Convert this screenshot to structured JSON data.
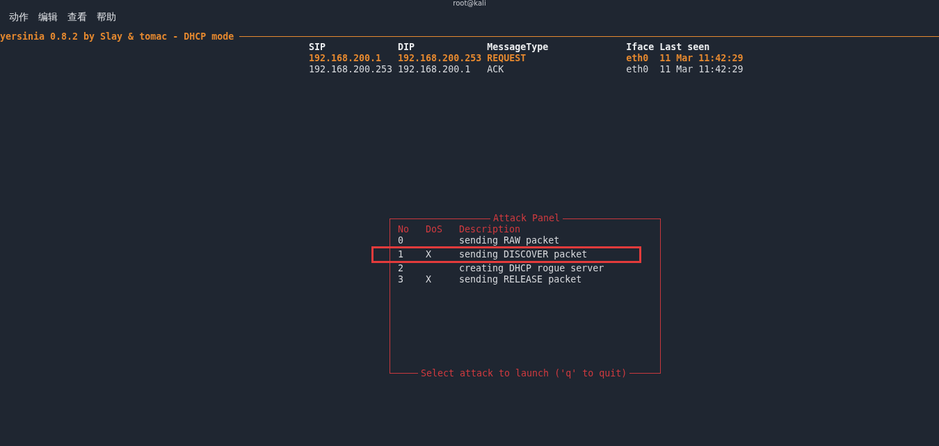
{
  "window": {
    "title": "root@kali"
  },
  "menu": [
    "动作",
    "编辑",
    "查看",
    "帮助"
  ],
  "app_title": "yersinia 0.8.2 by Slay & tomac - DHCP mode",
  "packets": {
    "columns": [
      "SIP",
      "DIP",
      "MessageType",
      "Iface",
      "Last seen"
    ],
    "rows": [
      {
        "cells": [
          "192.168.200.1",
          "192.168.200.253",
          "REQUEST",
          "eth0",
          "11 Mar 11:42:29"
        ],
        "selected": true
      },
      {
        "cells": [
          "192.168.200.253",
          "192.168.200.1",
          "ACK",
          "eth0",
          "11 Mar 11:42:29"
        ],
        "selected": false
      }
    ]
  },
  "attack_panel": {
    "title": "Attack Panel",
    "columns": [
      "No",
      "DoS",
      "Description"
    ],
    "rows": [
      {
        "no": "0",
        "description": "sending RAW packet",
        "highlighted": false
      },
      {
        "no": "1",
        "dos": "X",
        "description": "sending DISCOVER packet",
        "highlighted": true
      },
      {
        "no": "2",
        "description": "creating DHCP rogue server",
        "highlighted": false
      },
      {
        "no": "3",
        "dos": "X",
        "description": "sending RELEASE packet",
        "highlighted": false
      }
    ],
    "footer": "Select attack to launch ('q' to quit)"
  }
}
